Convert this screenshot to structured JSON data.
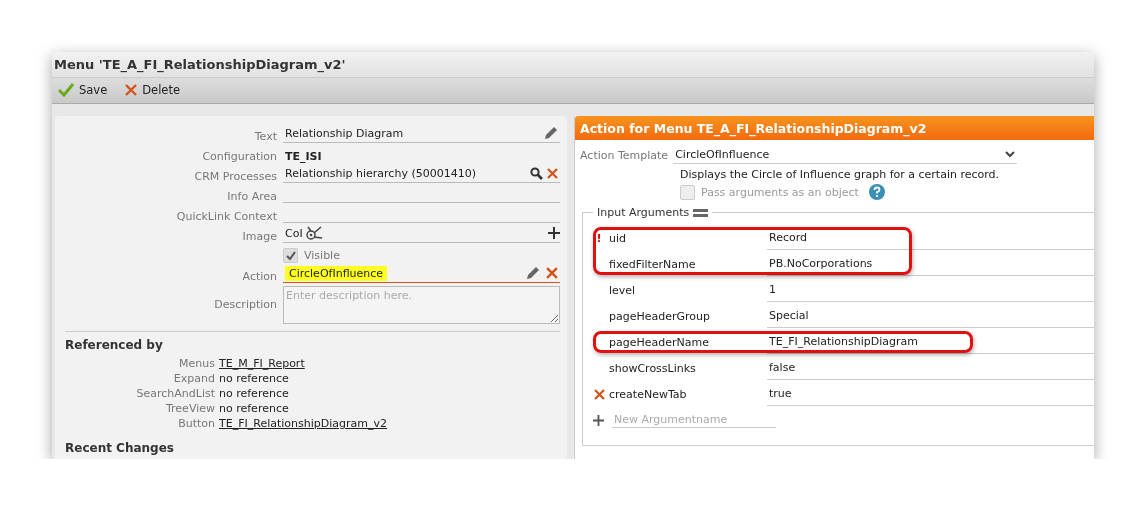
{
  "window": {
    "title": "Menu 'TE_A_FI_RelationshipDiagram_v2'"
  },
  "toolbar": [
    {
      "kind": "save",
      "label": "Save"
    },
    {
      "kind": "delete",
      "label": "Delete"
    }
  ],
  "form": {
    "fields": [
      {
        "kind": "text",
        "label": "Text",
        "value": "Relationship Diagram",
        "editable": true
      },
      {
        "kind": "bold",
        "label": "Configuration",
        "value": "TE_ISI"
      },
      {
        "kind": "lookup",
        "label": "CRM Processes",
        "value": "Relationship hierarchy (50001410)"
      },
      {
        "kind": "text",
        "label": "Info Area",
        "editable": false
      },
      {
        "kind": "text",
        "label": "QuickLink Context",
        "editable": false
      },
      {
        "kind": "image",
        "label": "Image",
        "value": "CoI"
      },
      {
        "kind": "checkbox",
        "label": "Visible",
        "checked": true
      },
      {
        "kind": "action",
        "label": "Action",
        "value": "CircleOfInfluence",
        "highlighted": true
      },
      {
        "kind": "textarea",
        "label": "Description",
        "placeholder": "Enter description here."
      }
    ]
  },
  "referenced_by": {
    "title": "Referenced by",
    "rows": [
      {
        "label": "Menus",
        "value": "TE_M_FI_Report",
        "link": true
      },
      {
        "label": "Expand",
        "value": "no reference",
        "link": false
      },
      {
        "label": "SearchAndList",
        "value": "no reference",
        "link": false
      },
      {
        "label": "TreeView",
        "value": "no reference",
        "link": false
      },
      {
        "label": "Button",
        "value": "TE_FI_RelationshipDiagram_v2",
        "link": true
      }
    ]
  },
  "recent_changes": {
    "title": "Recent Changes"
  },
  "action_panel": {
    "title": "Action for Menu TE_A_FI_RelationshipDiagram_v2",
    "template_label": "Action Template",
    "template": "CircleOfInfluence",
    "template_description": "Displays the Circle of Influence graph for a certain record.",
    "pass_as_object": {
      "label": "Pass arguments as an object",
      "checked": false
    },
    "arguments_legend": "Input Arguments",
    "arguments": [
      {
        "name": "uid",
        "value": "Record",
        "required_mark": "!",
        "removable": false,
        "highlighted": true
      },
      {
        "name": "fixedFilterName",
        "value": "PB.NoCorporations",
        "removable": false,
        "highlighted": true
      },
      {
        "name": "level",
        "value": "1",
        "removable": false,
        "highlighted": false
      },
      {
        "name": "pageHeaderGroup",
        "value": "Special",
        "removable": false,
        "highlighted": false
      },
      {
        "name": "pageHeaderName",
        "value": "TE_FI_RelationshipDiagram",
        "removable": false,
        "highlighted": true
      },
      {
        "name": "showCrossLinks",
        "value": "false",
        "removable": false,
        "highlighted": false
      },
      {
        "name": "createNewTab",
        "value": "true",
        "removable": true,
        "highlighted": false
      }
    ],
    "new_argument": {
      "placeholder": "New Argumentname"
    }
  }
}
